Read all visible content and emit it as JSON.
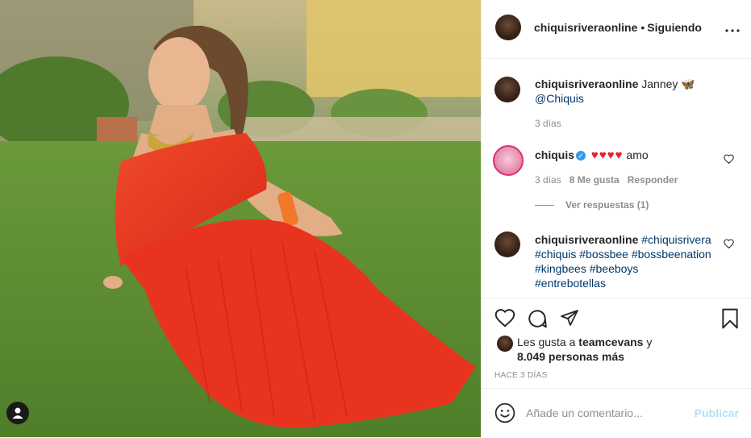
{
  "post": {
    "author": "chiquisriveraonline",
    "follow_status": "Siguiendo",
    "separator": "•"
  },
  "comments": [
    {
      "user": "chiquisriveraonline",
      "text": "Janney 🦋",
      "mention": "@Chiquis",
      "time": "3 días"
    },
    {
      "user": "chiquis",
      "verified": true,
      "hearts": "♥♥♥♥",
      "text": "amo",
      "time": "3 días",
      "likes": "8 Me gusta",
      "reply": "Responder",
      "view_replies": "Ver respuestas (1)"
    },
    {
      "user": "chiquisriveraonline",
      "hashtags": "#chiquisrivera #chiquis #bossbee #bossbeenation #kingbees #beeboys #entrebotellas"
    }
  ],
  "likes": {
    "prefix": "Les gusta a",
    "user": "teamcevans",
    "suffix": "y",
    "others": "8.049 personas más"
  },
  "timestamp": "HACE 3 DÍAS",
  "compose": {
    "placeholder": "Añade un comentario...",
    "publish": "Publicar"
  },
  "colors": {
    "accent": "#3897f0",
    "publish_disabled": "#b2dffc",
    "secondary_text": "#8e8e8e",
    "heart_red": "#e0202a",
    "dress_red": "#e8341f"
  },
  "icons": [
    "more-options-icon",
    "heart-icon",
    "comment-icon",
    "share-icon",
    "bookmark-icon",
    "smile-icon",
    "user-tag-icon",
    "verified-icon"
  ]
}
